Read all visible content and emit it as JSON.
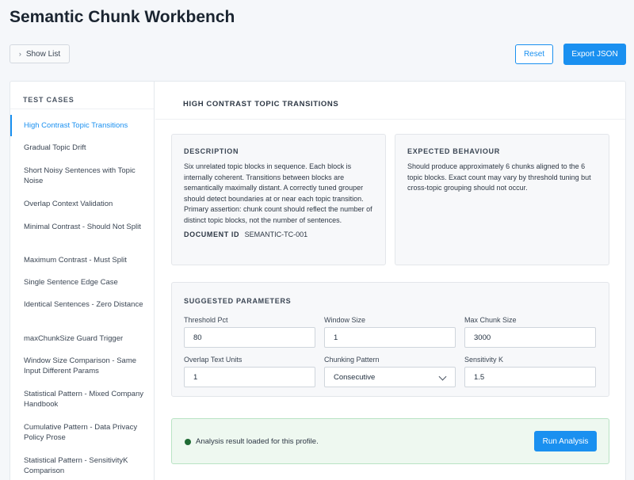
{
  "app": {
    "title": "Semantic Chunk Workbench"
  },
  "toolbar": {
    "show_list": "Show List",
    "reset": "Reset",
    "export": "Export JSON"
  },
  "sidebar": {
    "heading": "TEST CASES",
    "items": [
      "High Contrast Topic Transitions",
      "Gradual Topic Drift",
      "Short Noisy Sentences with Topic Noise",
      "Overlap Context Validation",
      "Minimal Contrast - Should Not Split",
      "Maximum Contrast - Must Split",
      "Single Sentence Edge Case",
      "Identical Sentences - Zero Distance",
      "maxChunkSize Guard Trigger",
      "Window Size Comparison - Same Input Different Params",
      "Statistical Pattern - Mixed Company Handbook",
      "Cumulative Pattern - Data Privacy Policy Prose",
      "Statistical Pattern - SensitivityK Comparison"
    ],
    "active_index": 0
  },
  "content": {
    "title": "HIGH CONTRAST TOPIC TRANSITIONS",
    "description": {
      "heading": "DESCRIPTION",
      "body": "Six unrelated topic blocks in sequence. Each block is internally coherent. Transitions between blocks are semantically maximally distant. A correctly tuned grouper should detect boundaries at or near each topic transition. Primary assertion: chunk count should reflect the number of distinct topic blocks, not the number of sentences.",
      "doc_id_label": "DOCUMENT ID",
      "doc_id": "SEMANTIC-TC-001"
    },
    "expected": {
      "heading": "EXPECTED BEHAVIOUR",
      "body": "Should produce approximately 6 chunks aligned to the 6 topic blocks. Exact count may vary by threshold tuning but cross-topic grouping should not occur."
    },
    "params": {
      "heading": "SUGGESTED PARAMETERS",
      "threshold_pct": {
        "label": "Threshold Pct",
        "value": "80"
      },
      "window_size": {
        "label": "Window Size",
        "value": "1"
      },
      "max_chunk_size": {
        "label": "Max Chunk Size",
        "value": "3000"
      },
      "overlap_text_units": {
        "label": "Overlap Text Units",
        "value": "1"
      },
      "chunking_pattern": {
        "label": "Chunking Pattern",
        "value": "Consecutive"
      },
      "sensitivity_k": {
        "label": "Sensitivity K",
        "value": "1.5"
      }
    },
    "status": {
      "message": "Analysis result loaded for this profile.",
      "run_button": "Run Analysis",
      "color": "#1f6b34"
    }
  },
  "colors": {
    "accent": "#1a90f0",
    "success_bg": "#eef8f0"
  }
}
